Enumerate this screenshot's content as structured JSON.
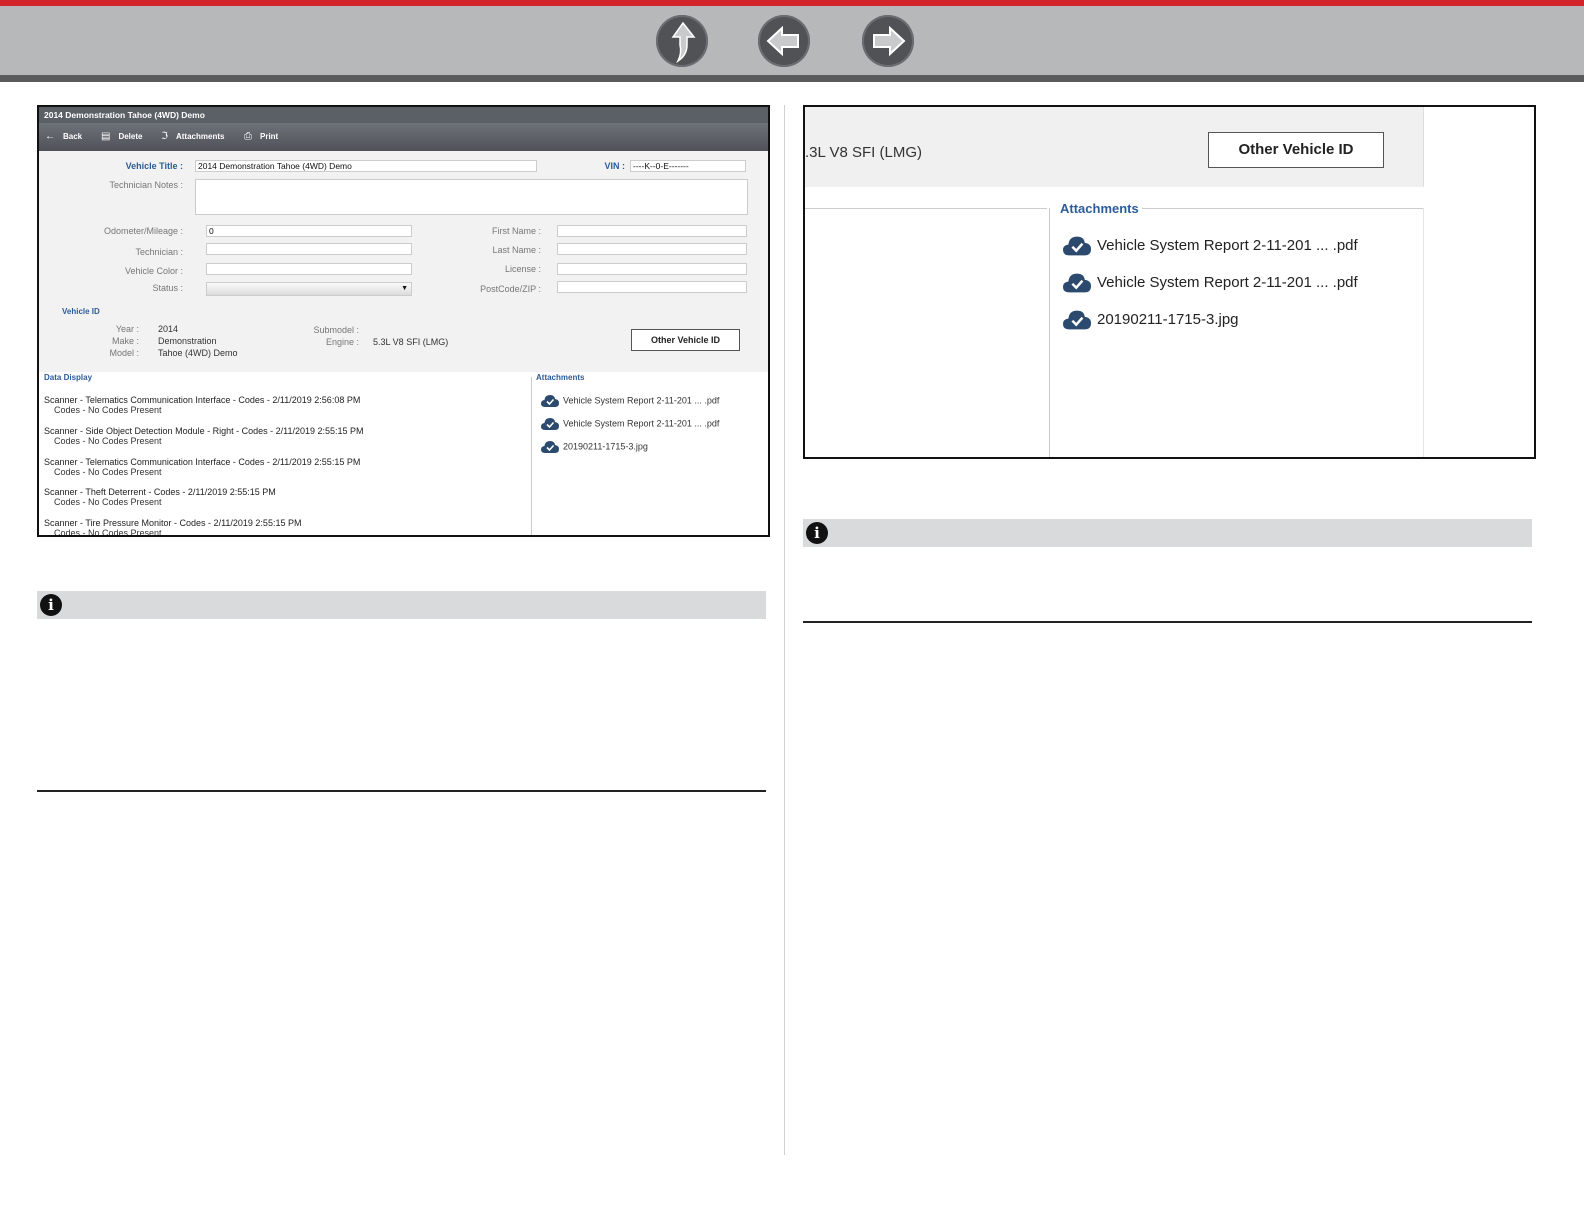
{
  "nav": {
    "colors": {
      "brand_red": "#d2232a",
      "bar_gray": "#b7b8ba",
      "button_dark": "#515256"
    },
    "buttons": [
      {
        "name": "up-arrow-icon"
      },
      {
        "name": "back-arrow-icon"
      },
      {
        "name": "forward-arrow-icon"
      }
    ]
  },
  "screenshot1": {
    "window_title": "2014 Demonstration Tahoe (4WD) Demo",
    "toolbar": {
      "back_label": "Back",
      "delete_label": "Delete",
      "attachments_label": "Attachments",
      "print_label": "Print"
    },
    "form": {
      "vehicle_title_label": "Vehicle Title :",
      "vehicle_title_value": "2014 Demonstration Tahoe (4WD) Demo",
      "vin_label": "VIN :",
      "vin_value": "----K--0-E-------",
      "technician_notes_label": "Technician Notes :",
      "odometer_label": "Odometer/Mileage :",
      "odometer_value": "0",
      "technician_label": "Technician :",
      "vehicle_color_label": "Vehicle Color :",
      "status_label": "Status :",
      "first_name_label": "First Name :",
      "last_name_label": "Last Name :",
      "license_label": "License :",
      "postcode_label": "PostCode/ZIP :"
    },
    "vehicle_id": {
      "section_label": "Vehicle ID",
      "year_label": "Year :",
      "year_value": "2014",
      "make_label": "Make :",
      "make_value": "Demonstration",
      "model_label": "Model :",
      "model_value": "Tahoe (4WD) Demo",
      "submodel_label": "Submodel :",
      "engine_label": "Engine :",
      "engine_value": "5.3L V8 SFI (LMG)",
      "other_button": "Other Vehicle ID"
    },
    "data_display": {
      "section_label": "Data Display",
      "items": [
        {
          "title": "Scanner - Telematics Communication Interface - Codes - 2/11/2019 2:56:08 PM",
          "sub": "Codes - No Codes Present"
        },
        {
          "title": "Scanner - Side Object Detection Module - Right - Codes - 2/11/2019 2:55:15 PM",
          "sub": "Codes - No Codes Present"
        },
        {
          "title": "Scanner - Telematics Communication Interface - Codes - 2/11/2019 2:55:15 PM",
          "sub": "Codes - No Codes Present"
        },
        {
          "title": "Scanner - Theft Deterrent - Codes - 2/11/2019 2:55:15 PM",
          "sub": "Codes - No Codes Present"
        },
        {
          "title": "Scanner - Tire Pressure Monitor - Codes - 2/11/2019 2:55:15 PM",
          "sub": "Codes - No Codes Present"
        }
      ]
    },
    "attachments": {
      "section_label": "Attachments",
      "items": [
        "Vehicle System Report 2-11-201 ... .pdf",
        "Vehicle System Report 2-11-201 ... .pdf",
        "20190211-1715-3.jpg"
      ]
    }
  },
  "screenshot2": {
    "engine_value": ".3L V8 SFI (LMG)",
    "other_button": "Other Vehicle ID",
    "attachments_label": "Attachments",
    "attachments": [
      "Vehicle System Report 2-11-201 ... .pdf",
      "Vehicle System Report 2-11-201 ... .pdf",
      "20190211-1715-3.jpg"
    ]
  },
  "notes": {
    "info_glyph": "i"
  }
}
